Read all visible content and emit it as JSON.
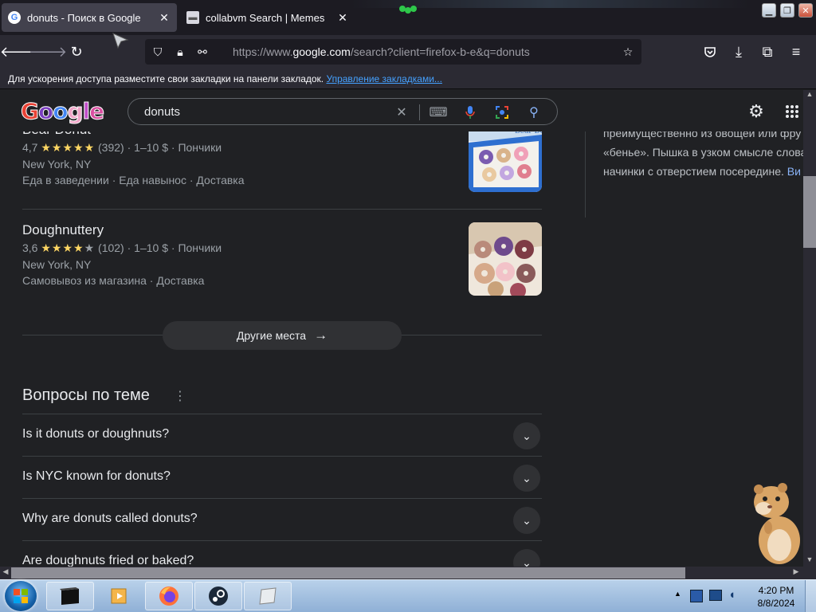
{
  "browser": {
    "tabs": [
      {
        "title": "donuts - Поиск в Google",
        "favicon": "G",
        "active": true
      },
      {
        "title": "collabvm Search | Memes",
        "favicon": "",
        "active": false
      }
    ],
    "url_prefix": "https://www.",
    "url_domain": "google.com",
    "url_rest": "/search?client=firefox-b-e&q=donuts",
    "bookmarks_text": "Для ускорения доступа разместите свои закладки на панели закладок.",
    "bookmarks_link": "Управление закладками..."
  },
  "google": {
    "logo_letters": [
      "G",
      "o",
      "o",
      "g",
      "l",
      "e"
    ],
    "query": "donuts"
  },
  "places": [
    {
      "name": "Bear Donut",
      "rating": "4,7",
      "stars": "★★★★★",
      "reviews": "(392)",
      "price": "1–10 $",
      "category": "Пончики",
      "location": "New York, NY",
      "services": "Еда в заведении · Еда навынос · Доставка"
    },
    {
      "name": "Doughnuttery",
      "rating": "3,6",
      "stars": "★★★★★",
      "reviews": "(102)",
      "price": "1–10 $",
      "category": "Пончики",
      "location": "New York, NY",
      "services": "Самовывоз из магазина · Доставка"
    }
  ],
  "more_places_label": "Другие места",
  "paa": {
    "title": "Вопросы по теме",
    "questions": [
      "Is it donuts or doughnuts?",
      "Is NYC known for donuts?",
      "Why are donuts called donuts?",
      "Are doughnuts fried or baked?"
    ]
  },
  "knowledge_panel": {
    "line1": "преимущественно из овощей или фру",
    "line2": "«бенье». Пышка в узком смысле слова",
    "line3": "начинки с отверстием посередине.",
    "more_link": "Ви"
  },
  "taskbar": {
    "time": "4:20 PM",
    "date": "8/8/2024"
  },
  "colors": {
    "page_bg": "#202124",
    "link": "#8ab4f8",
    "stars": "#fdd663",
    "firefox_chrome": "#2b2a33"
  }
}
